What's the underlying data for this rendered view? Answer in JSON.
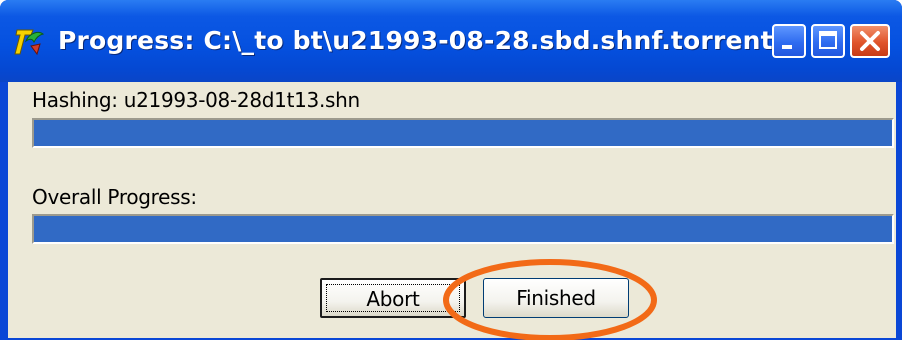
{
  "window": {
    "title": "Progress: C:\\_to bt\\u21993-08-28.sbd.shnf.torrent",
    "app_icon": "bittorrent-7-icon",
    "controls": {
      "minimize_icon": "minimize-icon",
      "maximize_icon": "maximize-icon",
      "close_icon": "close-icon"
    }
  },
  "hashing": {
    "label": "Hashing: u21993-08-28d1t13.shn",
    "progress": 1.0
  },
  "overall": {
    "label": "Overall Progress:",
    "progress": 1.0
  },
  "buttons": {
    "abort_label": "Abort",
    "finished_label": "Finished"
  },
  "annotation": {
    "type": "ellipse",
    "color": "#f26a17",
    "target": "finished-button"
  },
  "colors": {
    "titlebar": "#0551e0",
    "progress_fill": "#316ac5",
    "dialog_bg": "#ece9d8",
    "close_button": "#e0542a"
  }
}
